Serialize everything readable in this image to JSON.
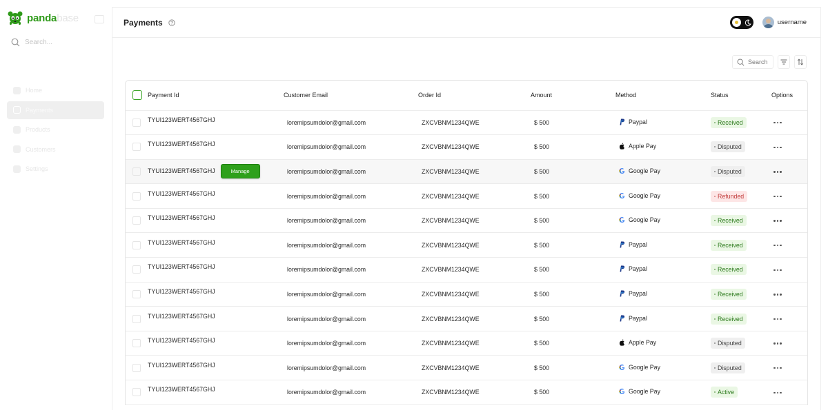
{
  "sidebar": {
    "logo_main": "panda",
    "logo_suffix": "base",
    "search_placeholder": "Search...",
    "items": [
      {
        "label": "Home",
        "active": false
      },
      {
        "label": "Payments",
        "active": true
      },
      {
        "label": "Products",
        "active": false
      },
      {
        "label": "Customers",
        "active": false
      },
      {
        "label": "Settings",
        "active": false
      }
    ]
  },
  "header": {
    "title": "Payments",
    "username": "username"
  },
  "toolbar": {
    "search_placeholder": "Search"
  },
  "table": {
    "columns": [
      "Payment Id",
      "Customer Email",
      "Order Id",
      "Amount",
      "Method",
      "Status",
      "Options"
    ],
    "manage_label": "Manage",
    "rows": [
      {
        "payment_id": "TYUI123WERT4567GHJ",
        "email": "loremipsumdolor@gmail.com",
        "order_id": "ZXCVBNM1234QWE",
        "amount": "$ 500",
        "method": "Paypal",
        "status": "Received"
      },
      {
        "payment_id": "TYUI123WERT4567GHJ",
        "email": "loremipsumdolor@gmail.com",
        "order_id": "ZXCVBNM1234QWE",
        "amount": "$ 500",
        "method": "Apple Pay",
        "status": "Disputed"
      },
      {
        "payment_id": "TYUI123WERT4567GHJ",
        "email": "loremipsumdolor@gmail.com",
        "order_id": "ZXCVBNM1234QWE",
        "amount": "$ 500",
        "method": "Google Pay",
        "status": "Disputed",
        "hover": true
      },
      {
        "payment_id": "TYUI123WERT4567GHJ",
        "email": "loremipsumdolor@gmail.com",
        "order_id": "ZXCVBNM1234QWE",
        "amount": "$ 500",
        "method": "Google Pay",
        "status": "Refunded"
      },
      {
        "payment_id": "TYUI123WERT4567GHJ",
        "email": "loremipsumdolor@gmail.com",
        "order_id": "ZXCVBNM1234QWE",
        "amount": "$ 500",
        "method": "Google Pay",
        "status": "Received"
      },
      {
        "payment_id": "TYUI123WERT4567GHJ",
        "email": "loremipsumdolor@gmail.com",
        "order_id": "ZXCVBNM1234QWE",
        "amount": "$ 500",
        "method": "Paypal",
        "status": "Received"
      },
      {
        "payment_id": "TYUI123WERT4567GHJ",
        "email": "loremipsumdolor@gmail.com",
        "order_id": "ZXCVBNM1234QWE",
        "amount": "$ 500",
        "method": "Paypal",
        "status": "Received"
      },
      {
        "payment_id": "TYUI123WERT4567GHJ",
        "email": "loremipsumdolor@gmail.com",
        "order_id": "ZXCVBNM1234QWE",
        "amount": "$ 500",
        "method": "Paypal",
        "status": "Received"
      },
      {
        "payment_id": "TYUI123WERT4567GHJ",
        "email": "loremipsumdolor@gmail.com",
        "order_id": "ZXCVBNM1234QWE",
        "amount": "$ 500",
        "method": "Paypal",
        "status": "Received"
      },
      {
        "payment_id": "TYUI123WERT4567GHJ",
        "email": "loremipsumdolor@gmail.com",
        "order_id": "ZXCVBNM1234QWE",
        "amount": "$ 500",
        "method": "Apple Pay",
        "status": "Disputed"
      },
      {
        "payment_id": "TYUI123WERT4567GHJ",
        "email": "loremipsumdolor@gmail.com",
        "order_id": "ZXCVBNM1234QWE",
        "amount": "$ 500",
        "method": "Google Pay",
        "status": "Disputed"
      },
      {
        "payment_id": "TYUI123WERT4567GHJ",
        "email": "loremipsumdolor@gmail.com",
        "order_id": "ZXCVBNM1234QWE",
        "amount": "$ 500",
        "method": "Google Pay",
        "status": "Active"
      }
    ]
  },
  "colors": {
    "brand": "#2f9a1a",
    "received_bg": "#eaf7e4",
    "disputed_bg": "#efefef",
    "refunded_bg": "#fde6e6"
  },
  "icons": {
    "paypal": "paypal-icon",
    "apple_pay": "apple-icon",
    "google_pay": "google-icon"
  }
}
